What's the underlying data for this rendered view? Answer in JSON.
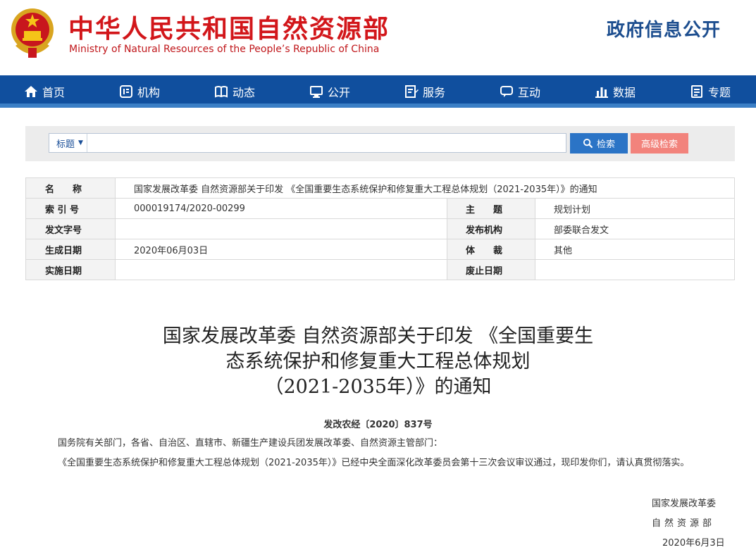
{
  "header": {
    "ministry_cn": "中华人民共和国自然资源部",
    "ministry_en": "Ministry of Natural Resources of the People’s Republic of China",
    "section_title": "政府信息公开"
  },
  "nav": {
    "items": [
      {
        "label": "首页",
        "icon": "home-icon"
      },
      {
        "label": "机构",
        "icon": "org-icon"
      },
      {
        "label": "动态",
        "icon": "book-icon"
      },
      {
        "label": "公开",
        "icon": "monitor-icon"
      },
      {
        "label": "服务",
        "icon": "edit-doc-icon"
      },
      {
        "label": "互动",
        "icon": "chat-icon"
      },
      {
        "label": "数据",
        "icon": "bar-chart-icon"
      },
      {
        "label": "专题",
        "icon": "topic-doc-icon"
      }
    ]
  },
  "search": {
    "scope_label": "标题",
    "input_value": "",
    "search_button": "检索",
    "advanced_button": "高级检索"
  },
  "meta": {
    "name_label": "名　　称",
    "name_value": "国家发展改革委 自然资源部关于印发 《全国重要生态系统保护和修复重大工程总体规划（2021-2035年）》的通知",
    "index_label": "索 引 号",
    "index_value": "000019174/2020-00299",
    "subject_label": "主　　题",
    "subject_value": "规划计划",
    "docno_label": "发文字号",
    "docno_value": "",
    "issuer_label": "发布机构",
    "issuer_value": "部委联合发文",
    "date_label": "生成日期",
    "date_value": "2020年06月03日",
    "genre_label": "体　　裁",
    "genre_value": "其他",
    "effective_label": "实施日期",
    "effective_value": "",
    "repeal_label": "废止日期",
    "repeal_value": ""
  },
  "document": {
    "title_line1": "国家发展改革委 自然资源部关于印发 《全国重要生",
    "title_line2": "态系统保护和修复重大工程总体规划",
    "title_line3": "（2021-2035年）》的通知",
    "doc_number": "发改农经〔2020〕837号",
    "paragraph1": "国务院有关部门，各省、自治区、直辖市、新疆生产建设兵团发展改革委、自然资源主管部门：",
    "paragraph2": "《全国重要生态系统保护和修复重大工程总体规划（2021-2035年）》已经中央全面深化改革委员会第十三次会议审议通过，现印发你们，请认真贯彻落实。",
    "signature1": "国家发展改革委",
    "signature2": "自然资源部",
    "signature_date": "2020年6月3日"
  },
  "colors": {
    "brand_red": "#d2161a",
    "nav_blue": "#104f9e",
    "search_blue": "#2b74c6",
    "advanced_pink": "#f2837c"
  }
}
